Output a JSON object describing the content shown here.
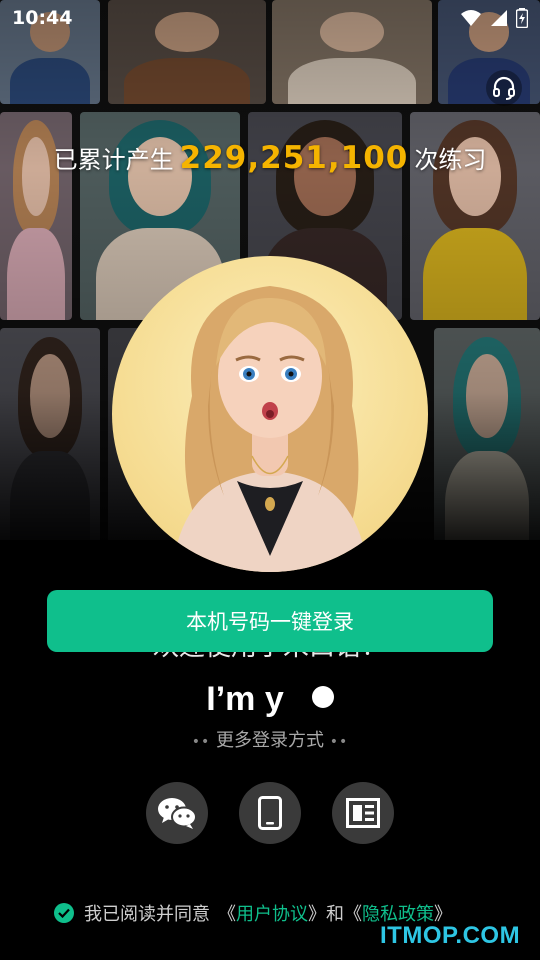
{
  "status_bar": {
    "time": "10:44"
  },
  "counter": {
    "prefix": "已累计产生",
    "number": "229,251,100",
    "suffix": "次练习"
  },
  "login": {
    "primary_button": "本机号码一键登录",
    "welcome_text": "欢迎使用小米口语！",
    "typing_text": "I’m y",
    "more_options": "更多登录方式",
    "alt_methods": [
      {
        "icon": "wechat-icon"
      },
      {
        "icon": "phone-icon"
      },
      {
        "icon": "account-icon"
      }
    ]
  },
  "agreement": {
    "prefix": "我已阅读并同意",
    "open_1": "《",
    "link_1": "用户协议",
    "close_1": "》",
    "conjunction": "和",
    "open_2": "《",
    "link_2": "隐私政策",
    "close_2": "》"
  },
  "watermark": "ITMOP.COM",
  "colors": {
    "accent": "#0fbf8c",
    "highlight": "#f5b400",
    "background": "#000000"
  }
}
